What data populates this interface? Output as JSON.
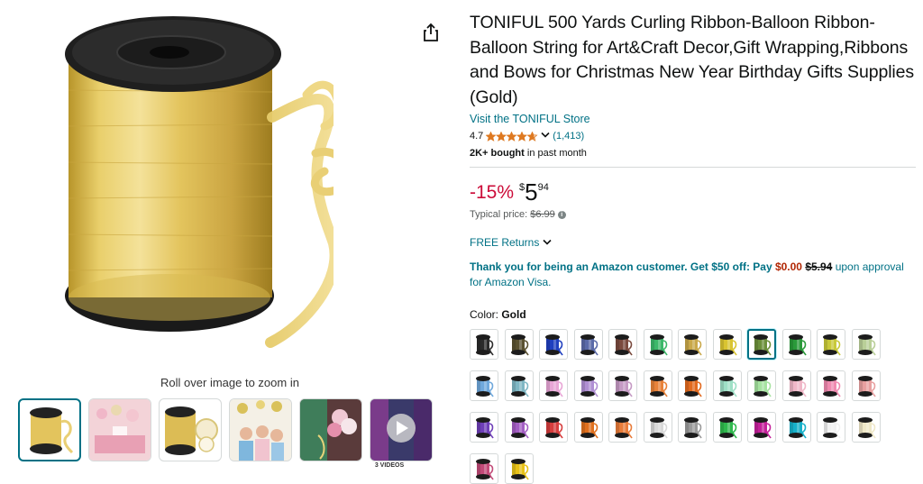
{
  "image": {
    "zoom_hint": "Roll over image to zoom in",
    "videos_label": "3 VIDEOS",
    "thumbnails": [
      {
        "name": "thumb-ribbon-spool",
        "kind": "spool",
        "selected": true
      },
      {
        "name": "thumb-party-decor",
        "kind": "party"
      },
      {
        "name": "thumb-spool-closeup",
        "kind": "spool2"
      },
      {
        "name": "thumb-kids-balloons",
        "kind": "kids"
      },
      {
        "name": "thumb-balloon-arrangement",
        "kind": "balloons"
      },
      {
        "name": "thumb-video",
        "kind": "video"
      }
    ]
  },
  "product": {
    "title": "TONIFUL 500 Yards Curling Ribbon-Balloon Ribbon-Balloon String for Art&Craft Decor,Gift Wrapping,Ribbons and Bows for Christmas New Year Birthday Gifts Supplies (Gold)",
    "store_link": "Visit the TONIFUL Store",
    "rating_value": "4.7",
    "rating_stars": 4.7,
    "rating_count": "(1,413)",
    "bought_bold": "2K+ bought",
    "bought_rest": " in past month",
    "discount": "-15%",
    "price_symbol": "$",
    "price_whole": "5",
    "price_fraction": "94",
    "typical_label": "Typical price:",
    "typical_price": "$6.99",
    "returns": "FREE Returns",
    "offer": {
      "lead": "Thank you for being an Amazon customer. Get $50 off: Pay ",
      "pay_amount": "$0.00",
      "old_amount": "$5.94",
      "tail": " upon approval for Amazon Visa."
    },
    "color_label": "Color: ",
    "color_value": "Gold"
  },
  "colors": {
    "accent_link": "#007185",
    "discount_red": "#cc0c39",
    "star_orange": "#de7921",
    "swatch_colors": [
      "#2b2b2b",
      "#5a5130",
      "#1f3fbf",
      "#5a6aa8",
      "#7a4a3e",
      "#3cb86a",
      "#c9a84a",
      "#d9c431",
      "#6b8f3a",
      "#2a9a3a",
      "#c8c93a",
      "#b9cf98",
      "#6fa8dc",
      "#7fb7c4",
      "#e8a6d6",
      "#b08fd3",
      "#c59ac4",
      "#e8823a",
      "#e26a1f",
      "#9ee0c6",
      "#a6e3a0",
      "#f0b7c8",
      "#f08ab0",
      "#e8a0a0",
      "#6e3fb8",
      "#a45fc4",
      "#d63d3d",
      "#e0701e",
      "#e87c3a",
      "#d9d9d9",
      "#9a9a9a",
      "#2fb84d",
      "#c4209a",
      "#17b0c9",
      "#f2f2f2",
      "#efe8c8",
      "#c24a78",
      "#e8c219"
    ],
    "selected_swatch_index": 8
  }
}
